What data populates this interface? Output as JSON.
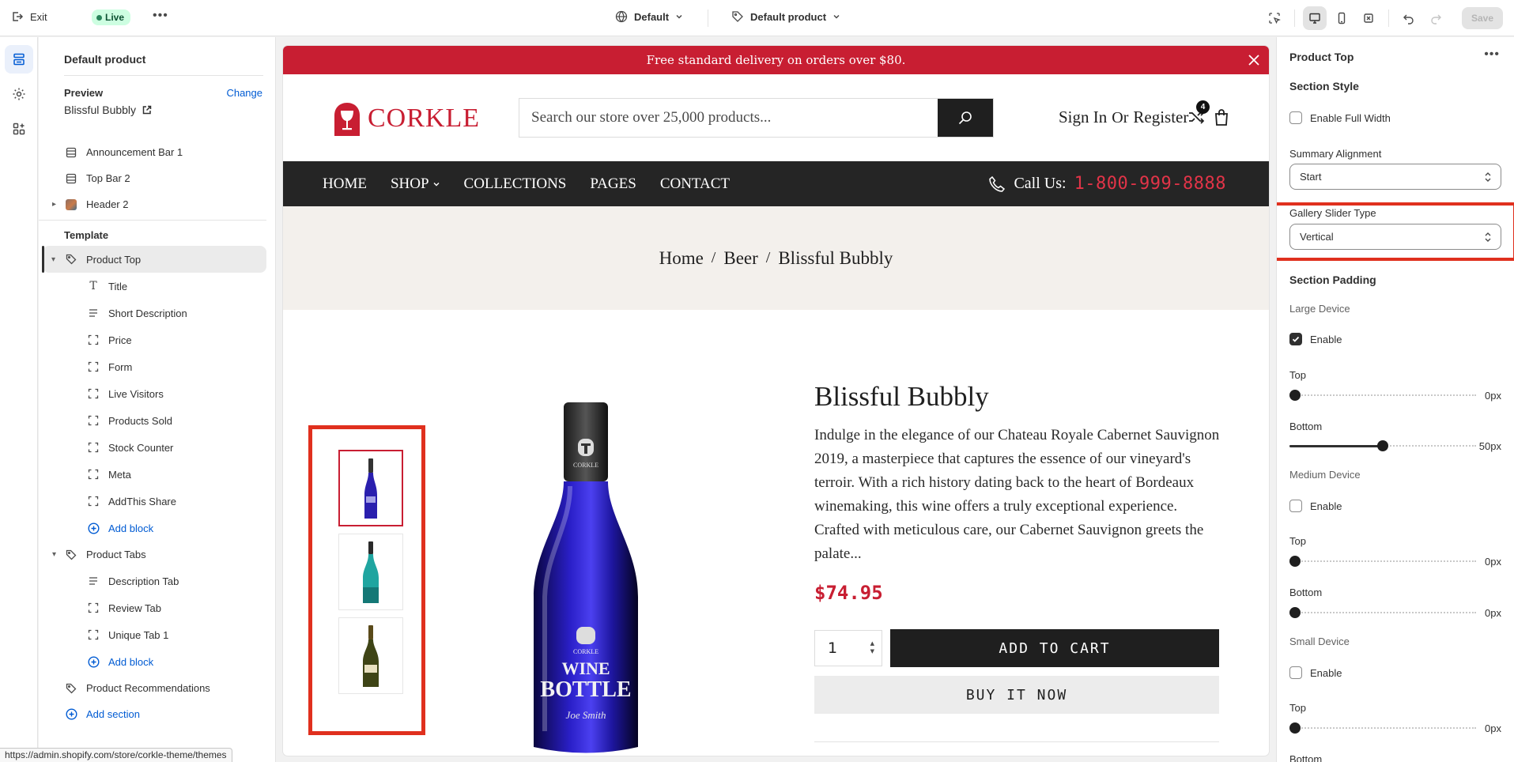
{
  "topbar": {
    "exit_label": "Exit",
    "live_label": "Live",
    "theme_select": "Default",
    "template_select": "Default product",
    "save_label": "Save"
  },
  "sidebar": {
    "title": "Default product",
    "preview_label": "Preview",
    "change_label": "Change",
    "preview_value": "Blissful Bubbly",
    "header_items": [
      "Announcement Bar 1",
      "Top Bar 2",
      "Header 2"
    ],
    "template_label": "Template",
    "product_top": {
      "label": "Product Top",
      "blocks": [
        "Title",
        "Short Description",
        "Price",
        "Form",
        "Live Visitors",
        "Products Sold",
        "Stock Counter",
        "Meta",
        "AddThis Share"
      ],
      "add_block": "Add block"
    },
    "product_tabs": {
      "label": "Product Tabs",
      "blocks": [
        "Description Tab",
        "Review Tab",
        "Unique Tab 1"
      ],
      "add_block": "Add block"
    },
    "product_recommendations": "Product Recommendations",
    "add_section": "Add section"
  },
  "store": {
    "announcement": "Free standard delivery on orders over $80.",
    "logo_text": "CORKLE",
    "search_placeholder": "Search our store over 25,000 products...",
    "account_sign_in": "Sign In",
    "account_or": "Or",
    "account_register": "Register",
    "compare_count": "4",
    "nav": [
      "HOME",
      "SHOP",
      "COLLECTIONS",
      "PAGES",
      "CONTACT"
    ],
    "call_label": "Call Us:",
    "call_number": "1-800-999-8888",
    "breadcrumb": [
      "Home",
      "Beer",
      "Blissful Bubbly"
    ],
    "product": {
      "title": "Blissful Bubbly",
      "description": "Indulge in the elegance of our Chateau Royale Cabernet Sauvignon 2019, a masterpiece that captures the essence of our vineyard's terroir. With a rich history dating back to the heart of Bordeaux winemaking, this wine offers a truly exceptional experience. Crafted with meticulous care, our Cabernet Sauvignon greets the palate...",
      "price": "$74.95",
      "quantity": "1",
      "add_to_cart": "ADD TO CART",
      "buy_now": "BUY IT NOW",
      "bottle_label_brand": "CORKLE",
      "bottle_label_line1": "WINE",
      "bottle_label_line2": "BOTTLE",
      "bottle_label_signature": "Joe Smith"
    }
  },
  "panel": {
    "title": "Product Top",
    "section_style": "Section Style",
    "enable_full_width": "Enable Full Width",
    "summary_alignment_label": "Summary Alignment",
    "summary_alignment_value": "Start",
    "gallery_slider_label": "Gallery Slider Type",
    "gallery_slider_value": "Vertical",
    "section_padding": "Section Padding",
    "large_device": "Large Device",
    "medium_device": "Medium Device",
    "small_device": "Small Device",
    "enable": "Enable",
    "top": "Top",
    "bottom": "Bottom",
    "large_top_value": "0px",
    "large_bottom_value": "50px",
    "medium_top_value": "0px",
    "medium_bottom_value": "0px",
    "small_top_value": "0px",
    "large_enabled": true,
    "medium_enabled": false,
    "small_enabled": false,
    "large_top_fraction": 0,
    "large_bottom_fraction": 0.5,
    "medium_top_fraction": 0,
    "medium_bottom_fraction": 0,
    "small_top_fraction": 0
  },
  "status_url": "https://admin.shopify.com/store/corkle-theme/themes",
  "colors": {
    "brand_red": "#c81e32",
    "nav_dark": "#252525",
    "highlight_red": "#e0301e",
    "link_blue": "#005bd3"
  }
}
